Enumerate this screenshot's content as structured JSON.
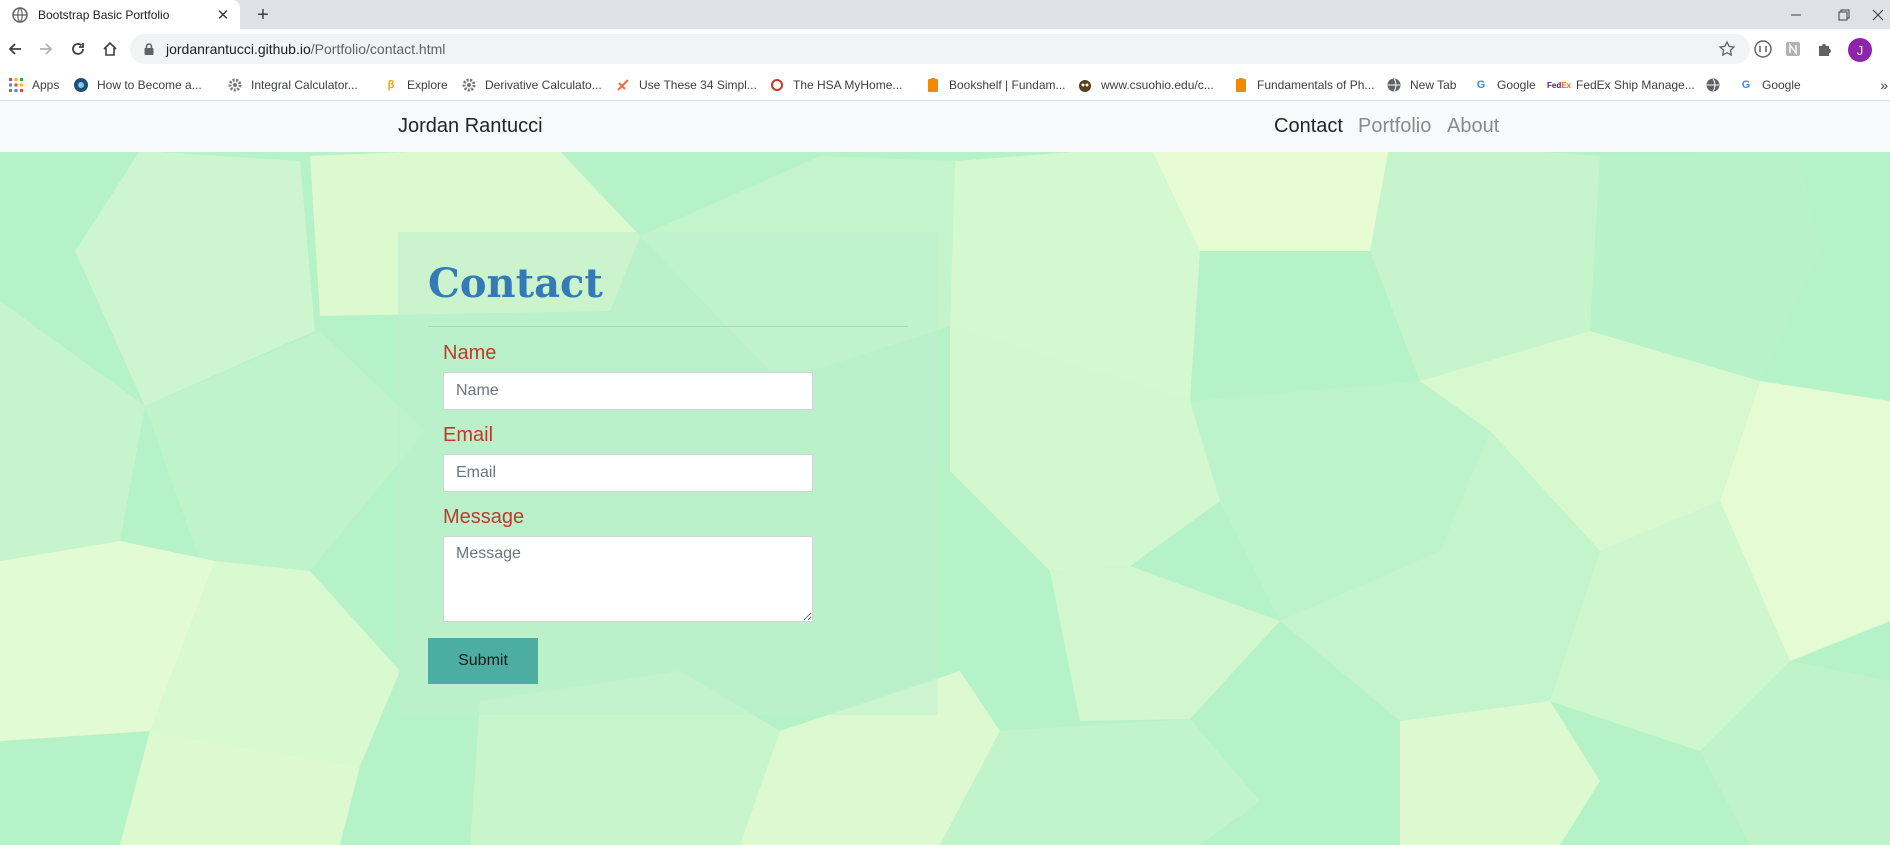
{
  "browser": {
    "tab_title": "Bootstrap Basic Portfolio",
    "tab_close": "✕",
    "new_tab": "+",
    "url_domain": "jordanrantucci.github.io",
    "url_path": "/Portfolio/contact.html",
    "profile_initial": "J",
    "bookmarks": [
      {
        "label": "Apps",
        "icon": "apps-grid-icon"
      },
      {
        "label": "How to Become a...",
        "icon": "site-icon"
      },
      {
        "label": "Integral Calculator...",
        "icon": "gear-icon"
      },
      {
        "label": "Explore",
        "icon": "site-icon"
      },
      {
        "label": "Derivative Calculato...",
        "icon": "gear-icon"
      },
      {
        "label": "Use These 34 Simpl...",
        "icon": "site-icon"
      },
      {
        "label": "The HSA MyHome...",
        "icon": "site-icon"
      },
      {
        "label": "Bookshelf | Fundam...",
        "icon": "bookmark-icon"
      },
      {
        "label": "www.csuohio.edu/c...",
        "icon": "site-icon"
      },
      {
        "label": "Fundamentals of Ph...",
        "icon": "bookmark-icon"
      },
      {
        "label": "New Tab",
        "icon": "globe-icon"
      },
      {
        "label": "Google",
        "icon": "google-icon"
      },
      {
        "label": "FedEx Ship Manage...",
        "icon": "fedex-icon"
      },
      {
        "label": "",
        "icon": "globe-icon"
      },
      {
        "label": "Google",
        "icon": "google-icon"
      }
    ],
    "bookmarks_more": "»"
  },
  "site_nav": {
    "brand": "Jordan Rantucci",
    "links": [
      {
        "label": "Contact",
        "active": true
      },
      {
        "label": "Portfolio",
        "active": false
      },
      {
        "label": "About",
        "active": false
      }
    ]
  },
  "contact_form": {
    "heading": "Contact",
    "name_label": "Name",
    "name_placeholder": "Name",
    "email_label": "Email",
    "email_placeholder": "Email",
    "message_label": "Message",
    "message_placeholder": "Message",
    "submit_label": "Submit"
  },
  "colors": {
    "heading": "#337ab7",
    "labels": "#c0392b",
    "submit_bg": "#4cada3",
    "background_primary": "#b5f2c8",
    "background_secondary": "#e6fbd4"
  }
}
